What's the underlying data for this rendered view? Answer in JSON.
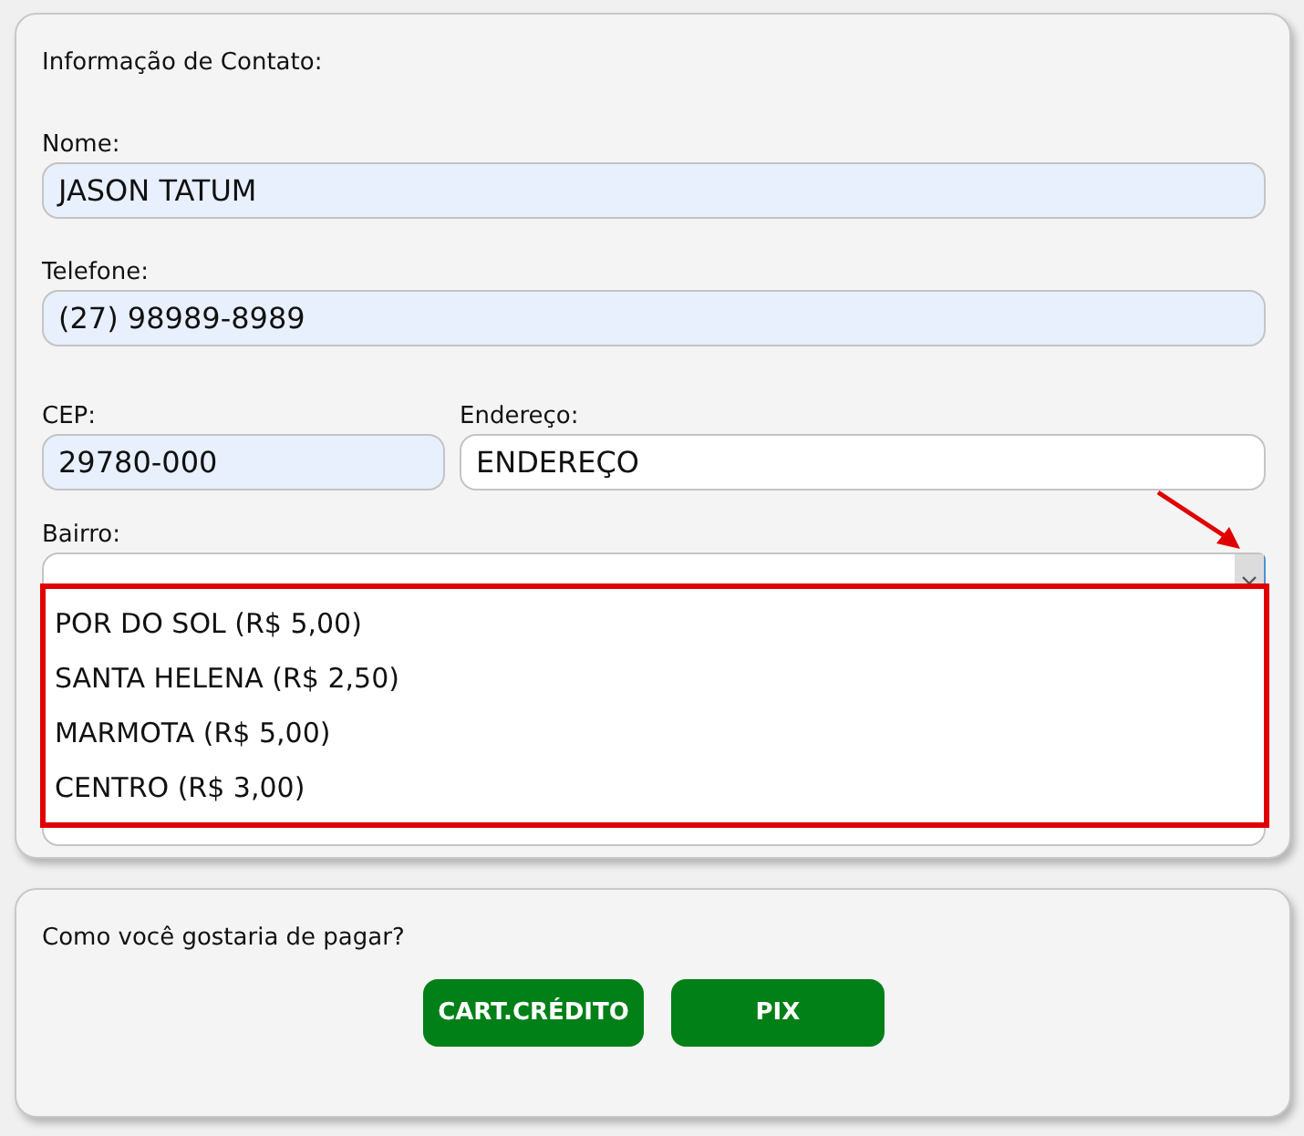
{
  "contact": {
    "title": "Informação de Contato:",
    "name": {
      "label": "Nome:",
      "value": "JASON TATUM",
      "autofilled": true
    },
    "phone": {
      "label": "Telefone:",
      "value": "(27) 98989-8989",
      "autofilled": true
    },
    "cep": {
      "label": "CEP:",
      "value": "29780-000",
      "autofilled": true
    },
    "address": {
      "label": "Endereço:",
      "value": "ENDEREÇO",
      "autofilled": false
    },
    "neighborhood": {
      "label": "Bairro:",
      "expanded": true,
      "options": [
        "POR DO SOL (R$ 5,00)",
        "SANTA HELENA (R$ 2,50)",
        "MARMOTA (R$ 5,00)",
        "CENTRO (R$ 3,00)"
      ]
    }
  },
  "payment": {
    "question": "Como você gostaria de pagar?",
    "buttons": [
      "CART.CRÉDITO",
      "PIX"
    ]
  }
}
